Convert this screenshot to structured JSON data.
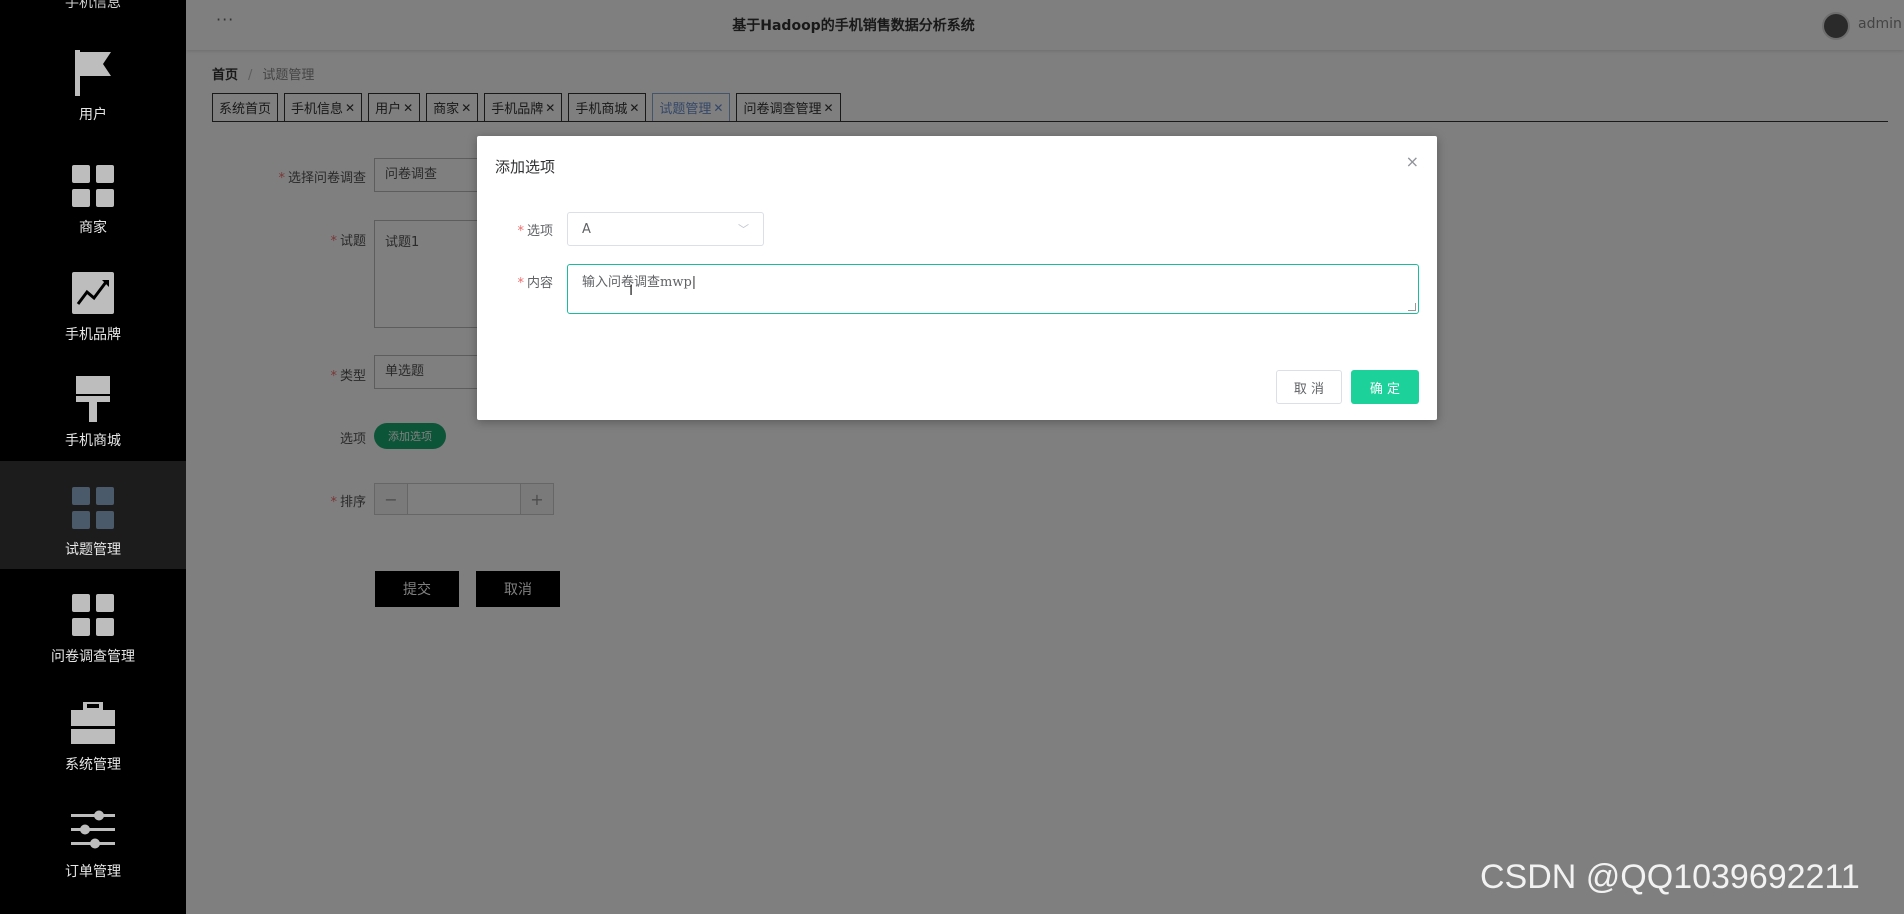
{
  "app": {
    "title": "基于Hadoop的手机销售数据分析系统",
    "user": "admin",
    "more_icon": "more-dots-icon"
  },
  "sidebar": {
    "partial_top_label": "手机信息",
    "items": [
      {
        "label": "用户",
        "icon": "flag-icon"
      },
      {
        "label": "商家",
        "icon": "grid-icon"
      },
      {
        "label": "手机品牌",
        "icon": "chart-icon"
      },
      {
        "label": "手机商城",
        "icon": "brush-icon"
      },
      {
        "label": "试题管理",
        "icon": "grid-icon",
        "active": true
      },
      {
        "label": "问卷调查管理",
        "icon": "grid-icon"
      },
      {
        "label": "系统管理",
        "icon": "briefcase-icon"
      },
      {
        "label": "订单管理",
        "icon": "sliders-icon"
      }
    ]
  },
  "breadcrumb": {
    "home": "首页",
    "separator": "/",
    "current": "试题管理"
  },
  "tabs": [
    {
      "label": "系统首页",
      "closable": false
    },
    {
      "label": "手机信息",
      "closable": true
    },
    {
      "label": "用户",
      "closable": true
    },
    {
      "label": "商家",
      "closable": true
    },
    {
      "label": "手机品牌",
      "closable": true
    },
    {
      "label": "手机商城",
      "closable": true
    },
    {
      "label": "试题管理",
      "closable": true,
      "active": true
    },
    {
      "label": "问卷调查管理",
      "closable": true
    }
  ],
  "form": {
    "survey_label": "选择问卷调查",
    "survey_value": "问卷调查",
    "question_label": "试题",
    "question_value": "试题1",
    "type_label": "类型",
    "type_value": "单选题",
    "options_label": "选项",
    "add_option_button": "添加选项",
    "order_label": "排序",
    "minus": "−",
    "plus": "+",
    "submit_button": "提交",
    "cancel_button": "取消"
  },
  "dialog": {
    "title": "添加选项",
    "close": "×",
    "option_label": "选项",
    "option_value": "A",
    "content_label": "内容",
    "content_value": "输入问卷调查mwp",
    "cancel_button": "取 消",
    "confirm_button": "确 定"
  },
  "colors": {
    "sidebar_bg": "#000000",
    "accent_green": "#1dd19a",
    "form_green": "#1aaa73",
    "required": "#f56c6c"
  },
  "watermark": "CSDN @QQ1039692211"
}
